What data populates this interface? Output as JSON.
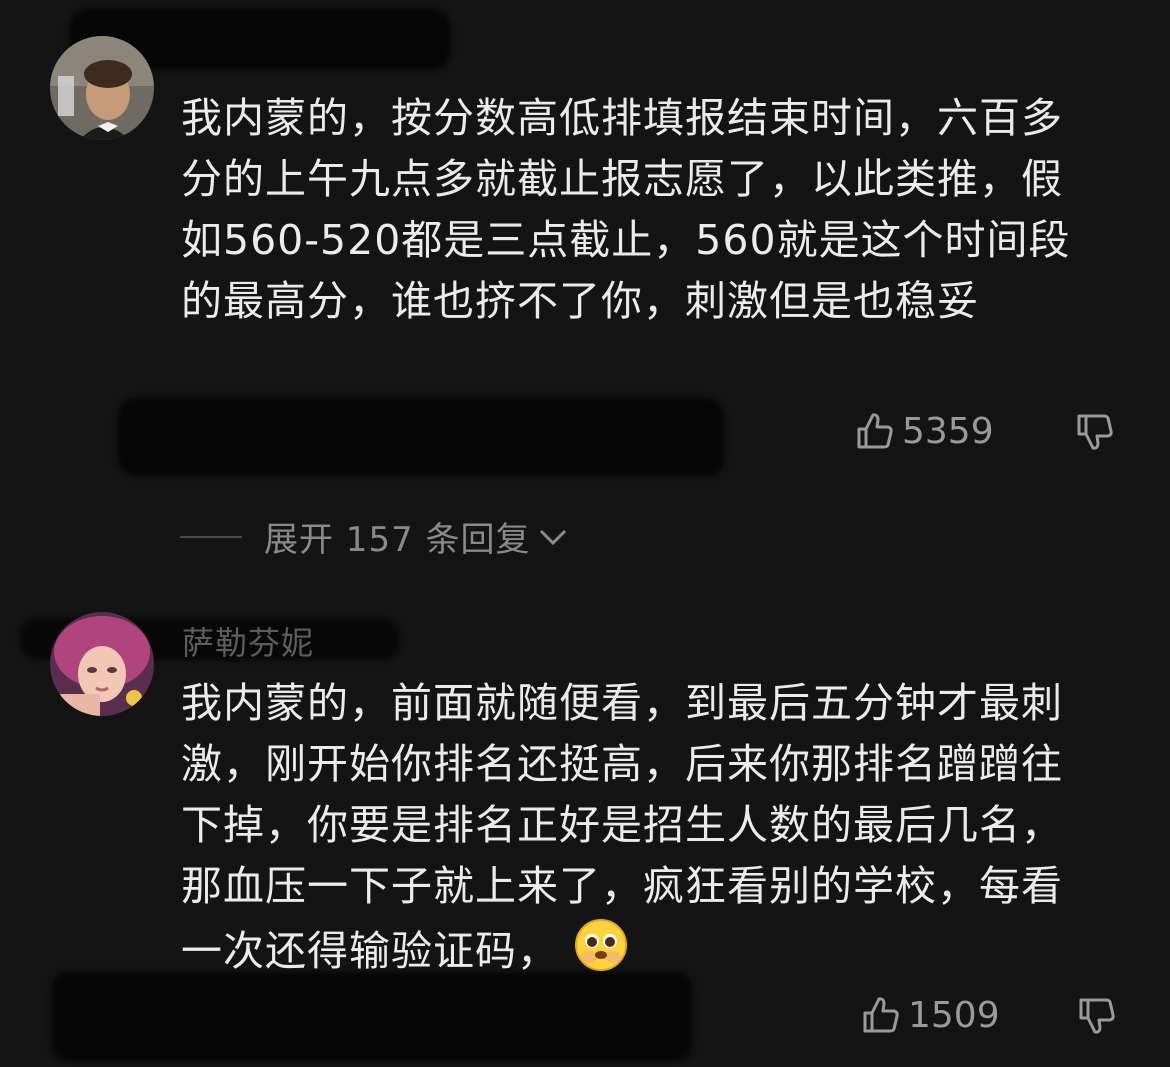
{
  "comments": [
    {
      "username": "",
      "text": "我内蒙的，按分数高低排填报结束时间，六百多分的上午九点多就截止报志愿了，以此类推，假如560-520都是三点截止，560就是这个时间段的最高分，谁也挤不了你，刺激但是也稳妥",
      "likes": "5359",
      "replies_label": "展开 157 条回复"
    },
    {
      "username": "萨勒芬妮",
      "text": "我内蒙的，前面就随便看，到最后五分钟才最刺激，刚开始你排名还挺高，后来你那排名蹭蹭往下掉，你要是排名正好是招生人数的最后几名，那血压一下子就上来了，疯狂看别的学校，每看一次还得输验证码，",
      "likes": "1509",
      "emoji": "pleading-face-emoji"
    }
  ],
  "icons": {
    "like": "thumbs-up-icon",
    "dislike": "thumbs-down-icon",
    "expand": "chevron-down-icon"
  },
  "colors": {
    "background": "#141414",
    "text": "#ebebeb",
    "muted": "#9a9a9a"
  }
}
